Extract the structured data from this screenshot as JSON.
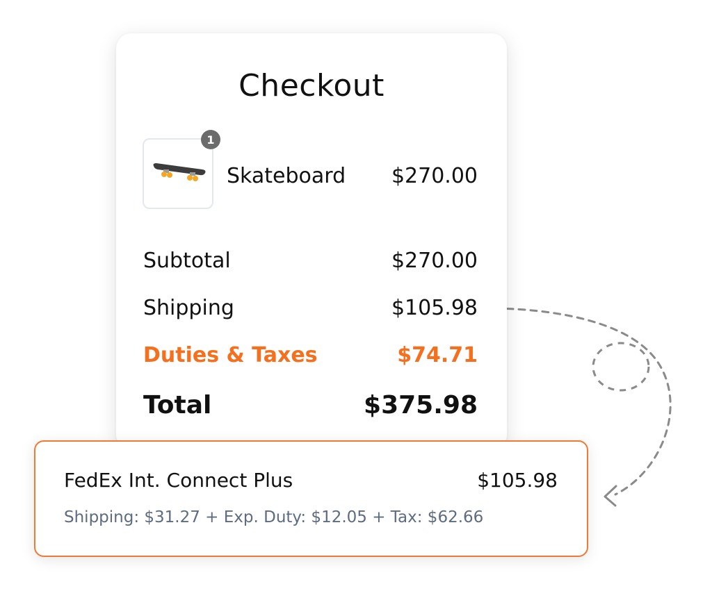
{
  "checkout": {
    "title": "Checkout",
    "item": {
      "name": "Skateboard",
      "price": "$270.00",
      "quantity_badge": "1",
      "image_icon": "skateboard-icon"
    },
    "subtotal": {
      "label": "Subtotal",
      "value": "$270.00"
    },
    "shipping": {
      "label": "Shipping",
      "value": "$105.98"
    },
    "duties": {
      "label": "Duties & Taxes",
      "value": "$74.71"
    },
    "total": {
      "label": "Total",
      "value": "$375.98"
    }
  },
  "shipping_option": {
    "carrier": "FedEx Int. Connect Plus",
    "price": "$105.98",
    "breakdown": "Shipping: $31.27 + Exp. Duty: $12.05 + Tax: $62.66"
  },
  "colors": {
    "accent_orange": "#f5701e",
    "border_orange": "#ee7a34",
    "muted_text": "#5e6c80",
    "badge_gray": "#6b6b6b"
  }
}
